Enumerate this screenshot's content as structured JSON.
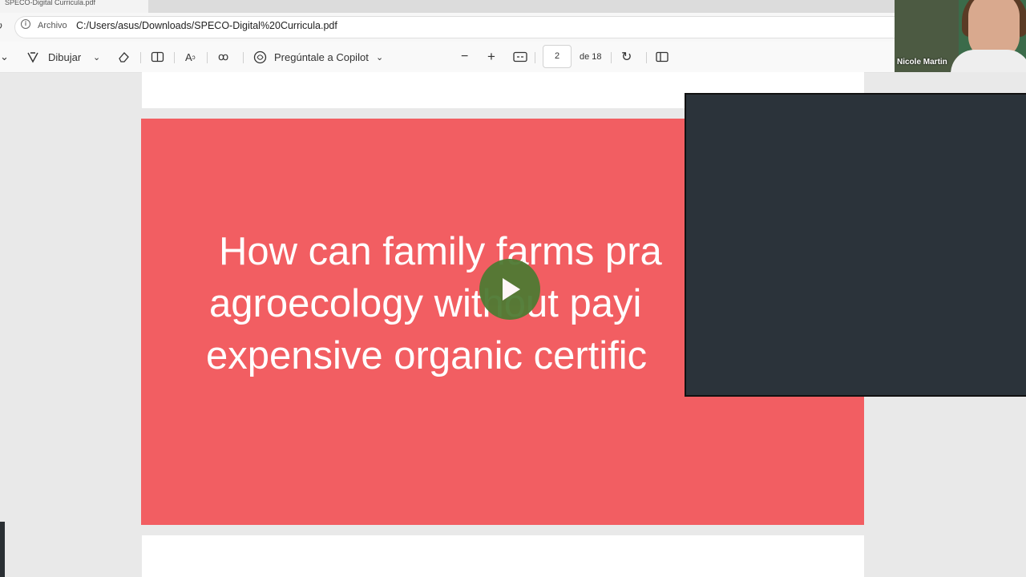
{
  "browser": {
    "tab_title": "SPECO-Digital Curricula.pdf",
    "scheme_label": "Archivo",
    "url": "C:/Users/asus/Downloads/SPECO-Digital%20Curricula.pdf"
  },
  "toolbar": {
    "draw_label": "Dibujar",
    "copilot_label": "Pregúntale a Copilot",
    "page_current": "2",
    "page_total": "de 18"
  },
  "slide": {
    "line1": "How can family farms pra",
    "line2": "agroecology without payi",
    "line3": "expensive organic certific",
    "background_color": "#f25e62"
  },
  "video": {
    "participant_name": "Nicole Martin"
  }
}
